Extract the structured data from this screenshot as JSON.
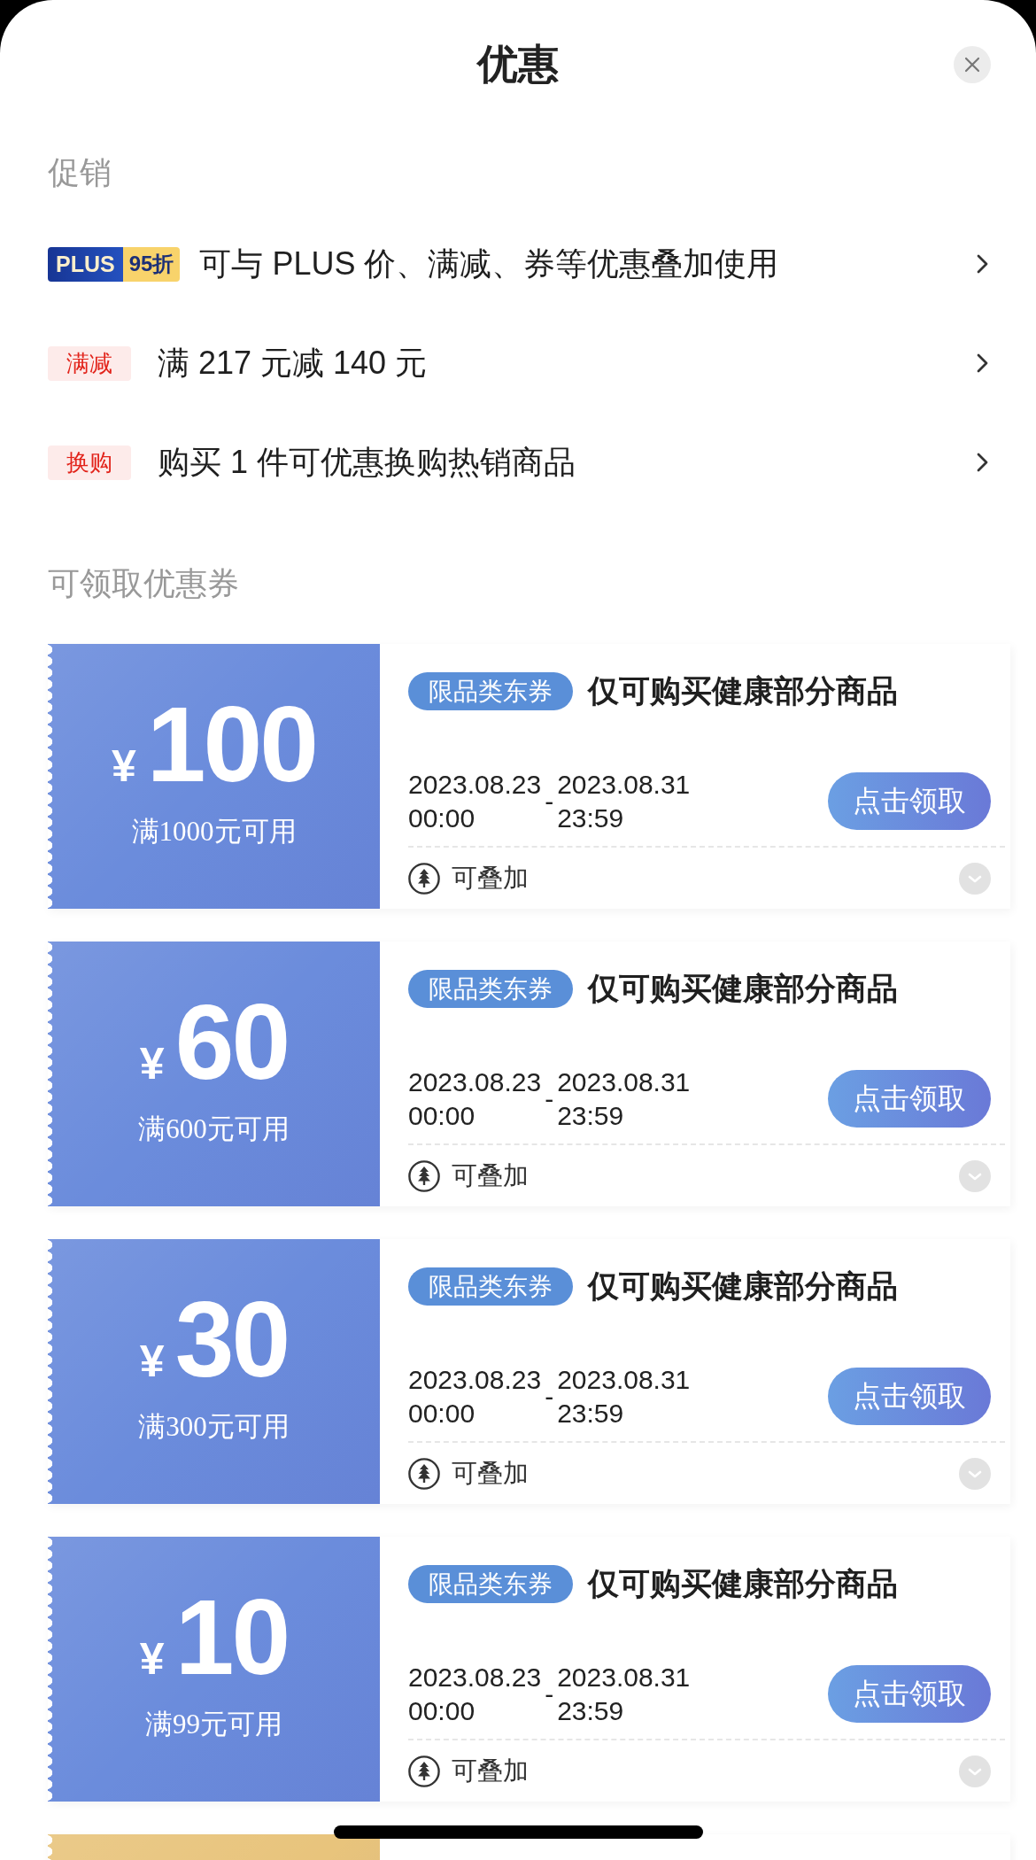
{
  "sheet": {
    "title": "优惠"
  },
  "promotions": {
    "heading": "促销",
    "items": [
      {
        "kind": "plus",
        "badge_left": "PLUS",
        "badge_right": "95折",
        "text": "可与 PLUS 价、满减、券等优惠叠加使用"
      },
      {
        "kind": "tag",
        "tag": "满减",
        "text": "满 217 元减 140 元"
      },
      {
        "kind": "tag",
        "tag": "换购",
        "text": "购买 1 件可优惠换购热销商品"
      }
    ]
  },
  "coupons": {
    "heading": "可领取优惠券",
    "items": [
      {
        "color": "#6b8cdc",
        "currency": "¥",
        "amount": "100",
        "condition": "满1000元可用",
        "tag": "限品类东券",
        "title": "仅可购买健康部分商品",
        "start_date": "2023.08.23",
        "start_time": "00:00",
        "separator": "-",
        "end_date": "2023.08.31",
        "end_time": "23:59",
        "button": "点击领取",
        "stackable": "可叠加",
        "expanded": false
      },
      {
        "color": "#6b8cdc",
        "currency": "¥",
        "amount": "60",
        "condition": "满600元可用",
        "tag": "限品类东券",
        "title": "仅可购买健康部分商品",
        "start_date": "2023.08.23",
        "start_time": "00:00",
        "separator": "-",
        "end_date": "2023.08.31",
        "end_time": "23:59",
        "button": "点击领取",
        "stackable": "可叠加",
        "expanded": false
      },
      {
        "color": "#6b8cdc",
        "currency": "¥",
        "amount": "30",
        "condition": "满300元可用",
        "tag": "限品类东券",
        "title": "仅可购买健康部分商品",
        "start_date": "2023.08.23",
        "start_time": "00:00",
        "separator": "-",
        "end_date": "2023.08.31",
        "end_time": "23:59",
        "button": "点击领取",
        "stackable": "可叠加",
        "expanded": false
      },
      {
        "color": "#6b8cdc",
        "currency": "¥",
        "amount": "10",
        "condition": "满99元可用",
        "tag": "限品类东券",
        "title": "仅可购买健康部分商品",
        "start_date": "2023.08.23",
        "start_time": "00:00",
        "separator": "-",
        "end_date": "2023.08.31",
        "end_time": "23:59",
        "button": "点击领取",
        "stackable": "可叠加",
        "expanded": false
      },
      {
        "color": "#e8c47c"
      }
    ]
  }
}
